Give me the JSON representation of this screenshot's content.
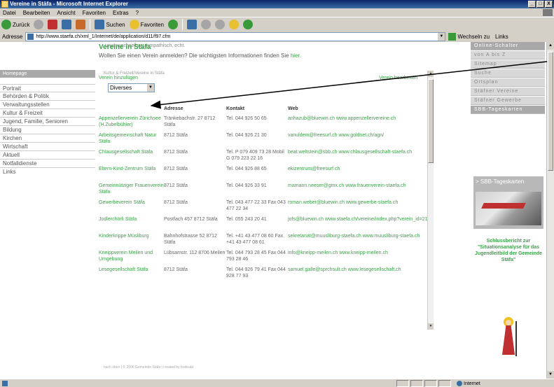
{
  "window": {
    "title": "Vereine in Stäfa - Microsoft Internet Explorer",
    "buttons": [
      "_",
      "□",
      "X"
    ]
  },
  "menu": [
    "Datei",
    "Bearbeiten",
    "Ansicht",
    "Favoriten",
    "Extras",
    "?"
  ],
  "toolbar": {
    "back_label": "Zurück",
    "search_label": "Suchen",
    "favorites_label": "Favoriten"
  },
  "addressbar": {
    "label": "Adresse",
    "url": "http://www.staefa.ch/xml_1/Internet/de/application/d11/f97.cfm",
    "go_label": "Wechseln zu",
    "links_label": "Links"
  },
  "page": {
    "top_cut_text": "unverwechselbar, sympathisch, echt.",
    "home_tab": "Homepage",
    "breadcrumb": "Kultur & Freizeit/Vereine in Stäfa",
    "left_nav": [
      "Portrait",
      "Behörden & Politik",
      "Verwaltungsstellen",
      "Kultur & Freizeit",
      "Jugend, Familie, Senioren",
      "Bildung",
      "Kirchen",
      "Wirtschaft",
      "Aktuell",
      "Notfalldienste",
      "Links"
    ],
    "heading": "Vereine in Stäfa",
    "intro": "Wollen Sie einen Verein anmelden? Die wichtigsten Informationen finden Sie",
    "intro_link": "hier.",
    "add_link": "Verein hinzufügen",
    "edit_link": "Verein bearbeiten",
    "category_select": "Diverses",
    "table": {
      "headers": [
        "",
        "Adresse",
        "Kontakt",
        "Web"
      ],
      "rows": [
        {
          "name": "Appenzellerverein Zürichsee (H.Zubelbühler)",
          "addr": "Tränkebachstr. 27 8712 Stäfa",
          "contact": "Tel. 044 926 50 65",
          "web": "anhazub@bluewin.ch www.appenzellervereine.ch"
        },
        {
          "name": "Arbeitsgemeinschaft Natur Stäfa",
          "addr": "8712 Stäfa",
          "contact": "Tel. 044 926 21 30",
          "web": "vanuldem@freesurf.ch www.goldnet.ch/agn/"
        },
        {
          "name": "Chlausgesellschaft Stäfa",
          "addr": "8712 Stäfa",
          "contact": "Tel. P 079 409 73 28 Mobil G 079 223 22 16",
          "web": "beat.weltstein@sbb.ch www.chlausgesellschaft-staefa.ch"
        },
        {
          "name": "Eltern-Kind-Zentrum Stäfa",
          "addr": "8712 Stäfa",
          "contact": "Tel. 044 926 88 65",
          "web": "ekizentrum@freesurf.ch"
        },
        {
          "name": "Gemeinnütziger Frauenverein Stäfa",
          "addr": "8712 Stäfa",
          "contact": "Tel. 044 926 33 91",
          "web": "mamann.neeser@gmx.ch www.frauenverein-staefa.ch"
        },
        {
          "name": "Gewerbeverein Stäfa",
          "addr": "8712 Stäfa",
          "contact": "Tel. 043 477 22 33 Fax 043 477 22 34",
          "web": "roman.weber@bluewin.ch www.gewerbe-staefa.ch"
        },
        {
          "name": "Jodlerchörli Stäfa",
          "addr": "Postfach 457 8712 Stäfa",
          "contact": "Tel. 055 243 20 41",
          "web": "jofs@bluewin.ch www.staefa.ch/vereine/index.php?verein_id=21"
        },
        {
          "name": "Kinderkrippe Müsliburg",
          "addr": "Bahnhofstrasse 52 8712 Stäfa",
          "contact": "Tel. +41 43 477 08 60 Fax +41 43 477 08 61",
          "web": "sekretariat@muusliburg-staefa.ch www.muusliburg-staefa.ch"
        },
        {
          "name": "Kneippverein Meilen und Umgebung",
          "addr": "Lübsamstr. 112 8706 Meilen",
          "contact": "Tel. 044 793 28 45 Fax 044 793 28 46",
          "web": "info@kneipp-meilen.ch www.kneipp-meilen.ch"
        },
        {
          "name": "Lesegesellschaft Stäfa",
          "addr": "8712 Stäfa",
          "contact": "Tel. 044 926 79 41 Fax 044 928 77 93",
          "web": "samuel.galle@sprchsult.ch www.lesegesellschaft.ch"
        }
      ]
    },
    "footer": "nach oben | © 2006 Gemeinde Stäfa | created by bodeabt",
    "right_nav": [
      "Online-Schalter",
      "von A bis Z",
      "Sitemap",
      "Suche",
      "Ortsplan",
      "Stäfner Vereine",
      "Stäfner Gewerbe",
      "SBB-Tageskarten"
    ],
    "sbb_title": "> SBB-Tageskarten",
    "report_text": "Schlussbericht zur \"Situationsanalyse für das Jugendleitbild der Gemeinde Stäfa\""
  },
  "status": {
    "zone": "Internet"
  },
  "colors": {
    "accent_green": "#3aa048",
    "nav_gray": "#a9a9a9"
  }
}
